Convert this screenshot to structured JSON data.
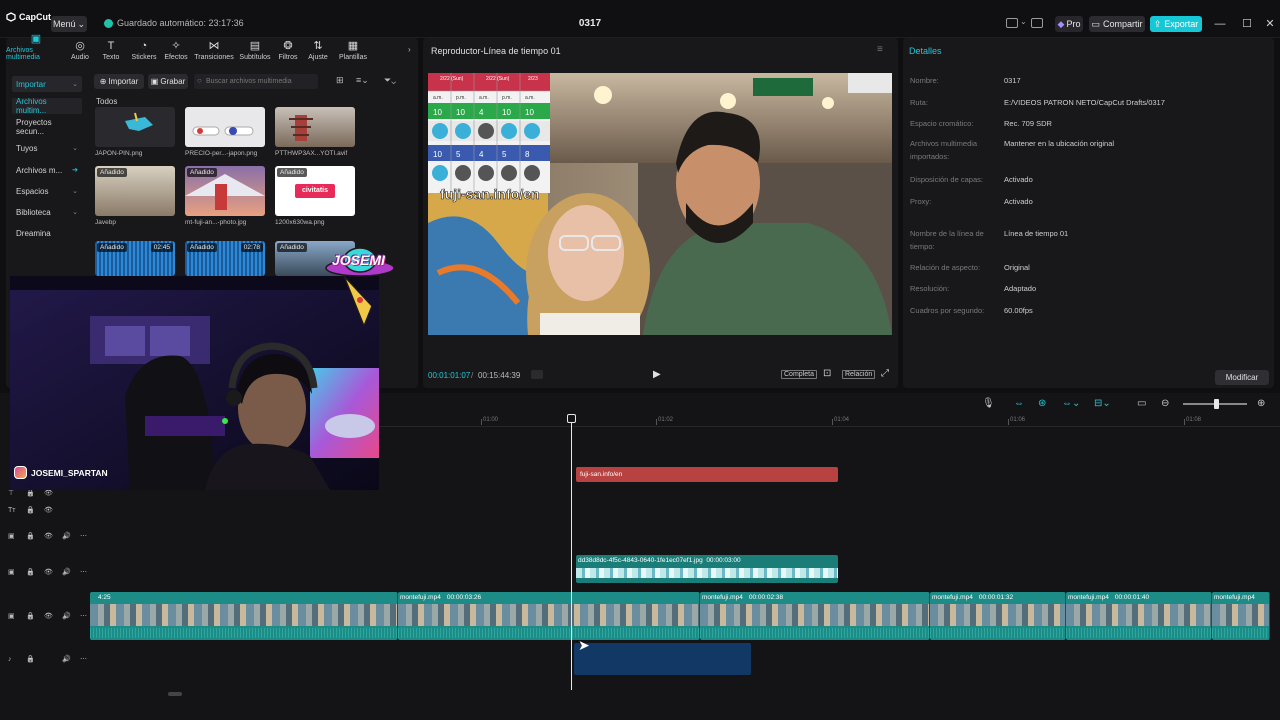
{
  "topbar": {
    "logo": "CapCut",
    "menu": "Menú",
    "autosave": "Guardado automático: 23:17:36",
    "project_title": "0317",
    "pro": "Pro",
    "share": "Compartir",
    "export": "Exportar"
  },
  "media_tabs": [
    {
      "label": "Archivos multimedia",
      "icon": "media-icon"
    },
    {
      "label": "Audio",
      "icon": "audio-icon"
    },
    {
      "label": "Texto",
      "icon": "text-icon"
    },
    {
      "label": "Stickers",
      "icon": "sticker-icon"
    },
    {
      "label": "Efectos",
      "icon": "effects-icon"
    },
    {
      "label": "Transiciones",
      "icon": "transitions-icon"
    },
    {
      "label": "Subtítulos",
      "icon": "subtitles-icon"
    },
    {
      "label": "Filtros",
      "icon": "filters-icon"
    },
    {
      "label": "Ajuste",
      "icon": "adjust-icon"
    },
    {
      "label": "Plantillas",
      "icon": "templates-icon"
    }
  ],
  "sidebar": {
    "items": [
      "Importar",
      "Archivos multim...",
      "Proyectos secun...",
      "Tuyos",
      "Archivos m...",
      "Espacios",
      "Biblioteca",
      "Dreamina"
    ]
  },
  "media_toolbar": {
    "import": "Importar",
    "record": "Grabar",
    "search_placeholder": "Buscar archivos multimedia",
    "section": "Todos"
  },
  "media_items": [
    {
      "name": "JAPON-PIN.png",
      "badge": ""
    },
    {
      "name": "PRECIO-per...-japon.png",
      "badge": ""
    },
    {
      "name": "PTTHWP3AX...YOTI.avif",
      "badge": ""
    },
    {
      "name": "Javebp",
      "badge": "Añadido"
    },
    {
      "name": "mt-fuji-an...-photo.jpg",
      "badge": "Añadido"
    },
    {
      "name": "1200x630wa.png",
      "badge": "Añadido"
    },
    {
      "name": "",
      "badge": "Añadido",
      "duration": "02:45"
    },
    {
      "name": "",
      "badge": "Añadido",
      "duration": "02:78"
    },
    {
      "name": "",
      "badge": "Añadido"
    }
  ],
  "civitatis_logo": "civitatis",
  "player": {
    "title": "Reproductor-Línea de tiempo 01",
    "overlay_text": "fuji-san.info/en",
    "time_current": "00:01:01:07",
    "time_total": "00:15:44:39",
    "full": "Completa",
    "ratio": "Relación"
  },
  "details": {
    "title": "Detalles",
    "rows": [
      {
        "k": "Nombre:",
        "v": "0317"
      },
      {
        "k": "Ruta:",
        "v": "E:/VIDEOS PATRON NETO/CapCut Drafts/0317"
      },
      {
        "k": "Espacio cromático:",
        "v": "Rec. 709 SDR"
      },
      {
        "k": "Archivos multimedia importados:",
        "v": "Mantener en la ubicación original"
      },
      {
        "k": "Disposición de capas:",
        "v": "Activado"
      },
      {
        "k": "Proxy:",
        "v": "Activado"
      },
      {
        "k": "Nombre de la línea de tiempo:",
        "v": "Línea de tiempo 01"
      },
      {
        "k": "Relación de aspecto:",
        "v": "Original"
      },
      {
        "k": "Resolución:",
        "v": "Adaptado"
      },
      {
        "k": "Cuadros por segundo:",
        "v": "60.00fps"
      }
    ],
    "modify": "Modificar"
  },
  "ruler_ticks": [
    "01:00",
    "01:02",
    "01:04",
    "01:06",
    "01:08"
  ],
  "timeline": {
    "text_clip": "fuji-san.info/en",
    "overlay_clip": "dd38d8dc-4f5c-4843-0640-1fe1ec07ef1.jpg",
    "overlay_clip_duration": "00:00:03:00",
    "main_clips": [
      {
        "name": "",
        "dur": "4:25"
      },
      {
        "name": "montefuji.mp4",
        "dur": "00:00:03:26"
      },
      {
        "name": "montefuji.mp4",
        "dur": "00:00:02:38"
      },
      {
        "name": "montefuji.mp4",
        "dur": "00:00:01:32"
      },
      {
        "name": "montefuji.mp4",
        "dur": "00:00:01:40"
      },
      {
        "name": "montefuji.mp4",
        "dur": ""
      }
    ]
  },
  "table_overlay": {
    "headers": [
      "2/22 (Sun)",
      "2/22 (Sun)",
      "2/23"
    ],
    "subheaders": [
      "a.m.",
      "p.m.",
      "a.m.",
      "p.m.",
      "a.m."
    ],
    "row1": [
      "10",
      "10",
      "4",
      "10",
      "10"
    ],
    "row3": [
      "10",
      "5",
      "4",
      "5",
      "8"
    ]
  },
  "webcam": {
    "handle": "JOSEMI_SPARTAN",
    "logo_text": "JOSEMI"
  },
  "colors": {
    "accent": "#23c8d8",
    "export": "#16c7d6",
    "text_clip": "#b84141",
    "video_clip": "#1d8c86",
    "audio_clip": "#123866"
  }
}
